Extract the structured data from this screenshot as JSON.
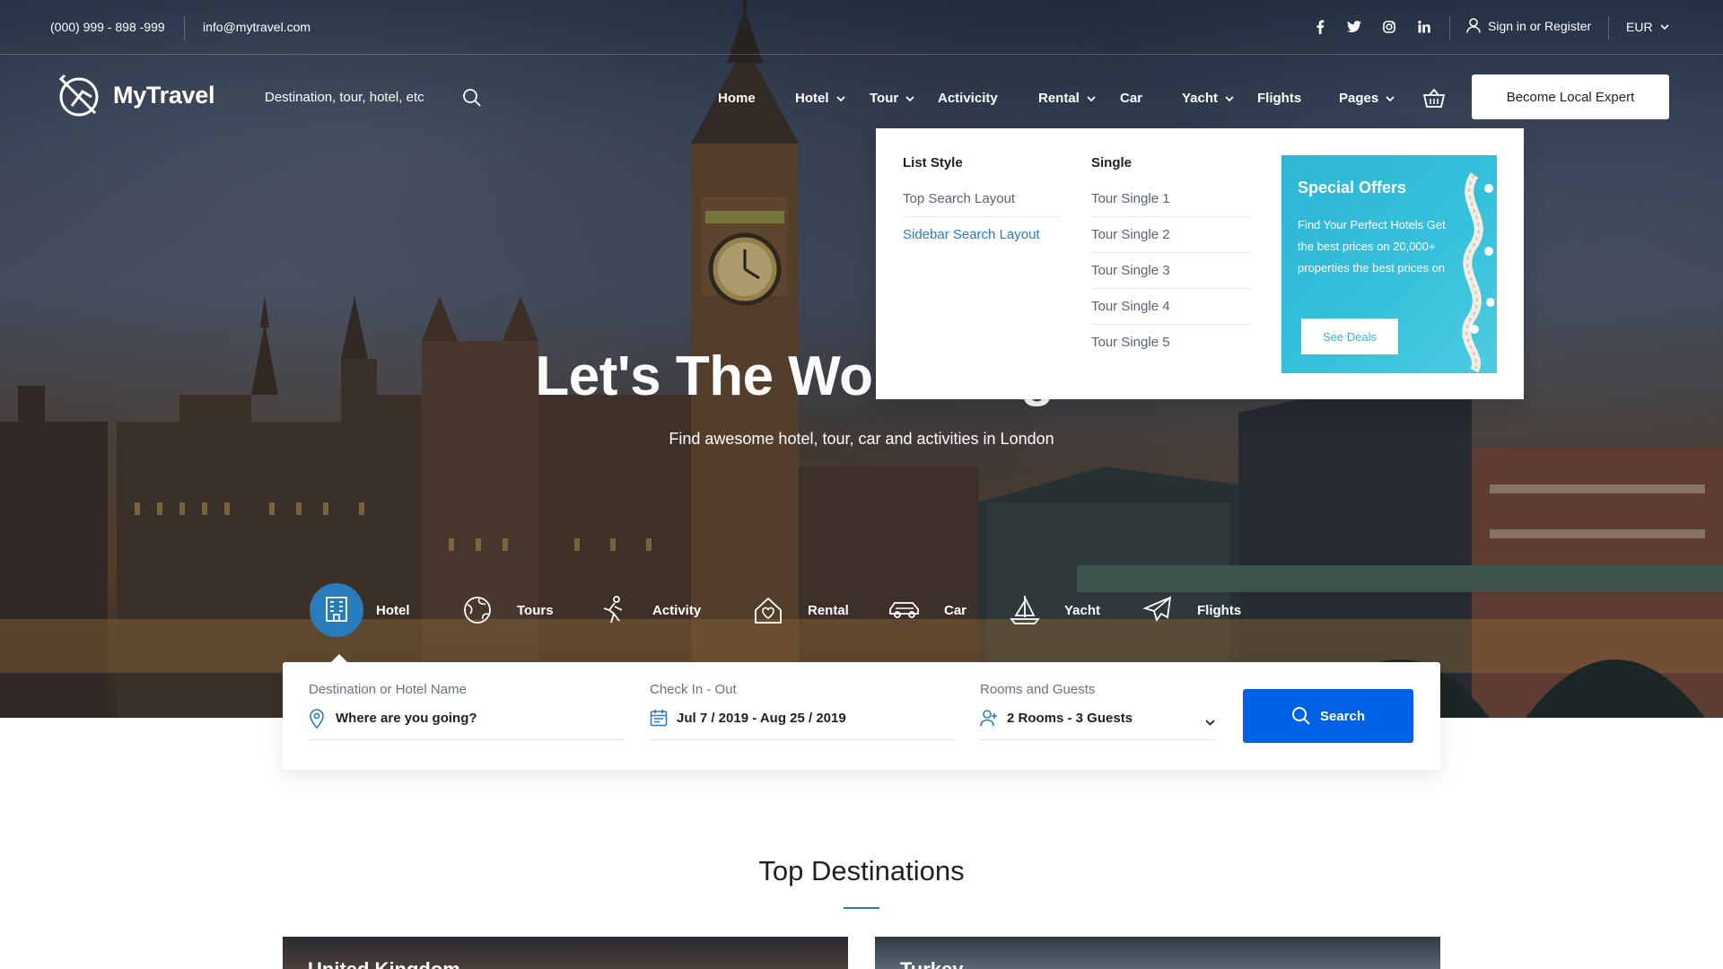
{
  "topbar": {
    "phone": "(000) 999 - 898 -999",
    "email": "info@mytravel.com",
    "social": [
      "facebook-icon",
      "twitter-icon",
      "instagram-icon",
      "linkedin-icon"
    ],
    "signin": "Sign in or Register",
    "currency": "EUR"
  },
  "brand": {
    "name": "MyTravel"
  },
  "search": {
    "placeholder": "Destination, tour, hotel, etc"
  },
  "nav": {
    "items": [
      {
        "label": "Home",
        "has_dropdown": false
      },
      {
        "label": "Hotel",
        "has_dropdown": true
      },
      {
        "label": "Tour",
        "has_dropdown": true
      },
      {
        "label": "Activicity",
        "has_dropdown": false
      },
      {
        "label": "Rental",
        "has_dropdown": true
      },
      {
        "label": "Car",
        "has_dropdown": false
      },
      {
        "label": "Yacht",
        "has_dropdown": true
      },
      {
        "label": "Flights",
        "has_dropdown": false
      },
      {
        "label": "Pages",
        "has_dropdown": true
      }
    ],
    "cta": "Become Local Expert"
  },
  "mega_menu": {
    "col1": {
      "title": "List Style",
      "links": [
        "Top Search Layout",
        "Sidebar Search Layout"
      ],
      "active_index": 1
    },
    "col2": {
      "title": "Single",
      "links": [
        "Tour Single 1",
        "Tour Single 2",
        "Tour Single 3",
        "Tour Single 4",
        "Tour Single 5"
      ]
    },
    "offer": {
      "title": "Special Offers",
      "text": "Find Your Perfect Hotels Get the best prices on 20,000+ properties the best  prices on",
      "button": "See Deals"
    }
  },
  "hero": {
    "headline": "Let's The World Together",
    "subhead": "Find awesome hotel, tour, car and activities in London"
  },
  "tabs": [
    {
      "label": "Hotel",
      "icon": "hotel-building-icon",
      "active": true
    },
    {
      "label": "Tours",
      "icon": "globe-tours-icon",
      "active": false
    },
    {
      "label": "Activity",
      "icon": "activity-icon",
      "active": false
    },
    {
      "label": "Rental",
      "icon": "house-heart-icon",
      "active": false
    },
    {
      "label": "Car",
      "icon": "car-icon",
      "active": false
    },
    {
      "label": "Yacht",
      "icon": "sailboat-icon",
      "active": false
    },
    {
      "label": "Flights",
      "icon": "plane-icon",
      "active": false
    }
  ],
  "search_form": {
    "destination": {
      "label": "Destination or Hotel Name",
      "value": "Where are you going?"
    },
    "dates": {
      "label": "Check In - Out",
      "value": "Jul 7 / 2019 - Aug 25 / 2019"
    },
    "guests": {
      "label": "Rooms and Guests",
      "value": "2 Rooms - 3 Guests"
    },
    "button": "Search"
  },
  "destinations": {
    "title": "Top Destinations",
    "cards": [
      "United Kingdom",
      "Turkey"
    ]
  },
  "colors": {
    "primary": "#297cbb",
    "search_button": "#0062e6",
    "offer": "#2fb6d6"
  }
}
